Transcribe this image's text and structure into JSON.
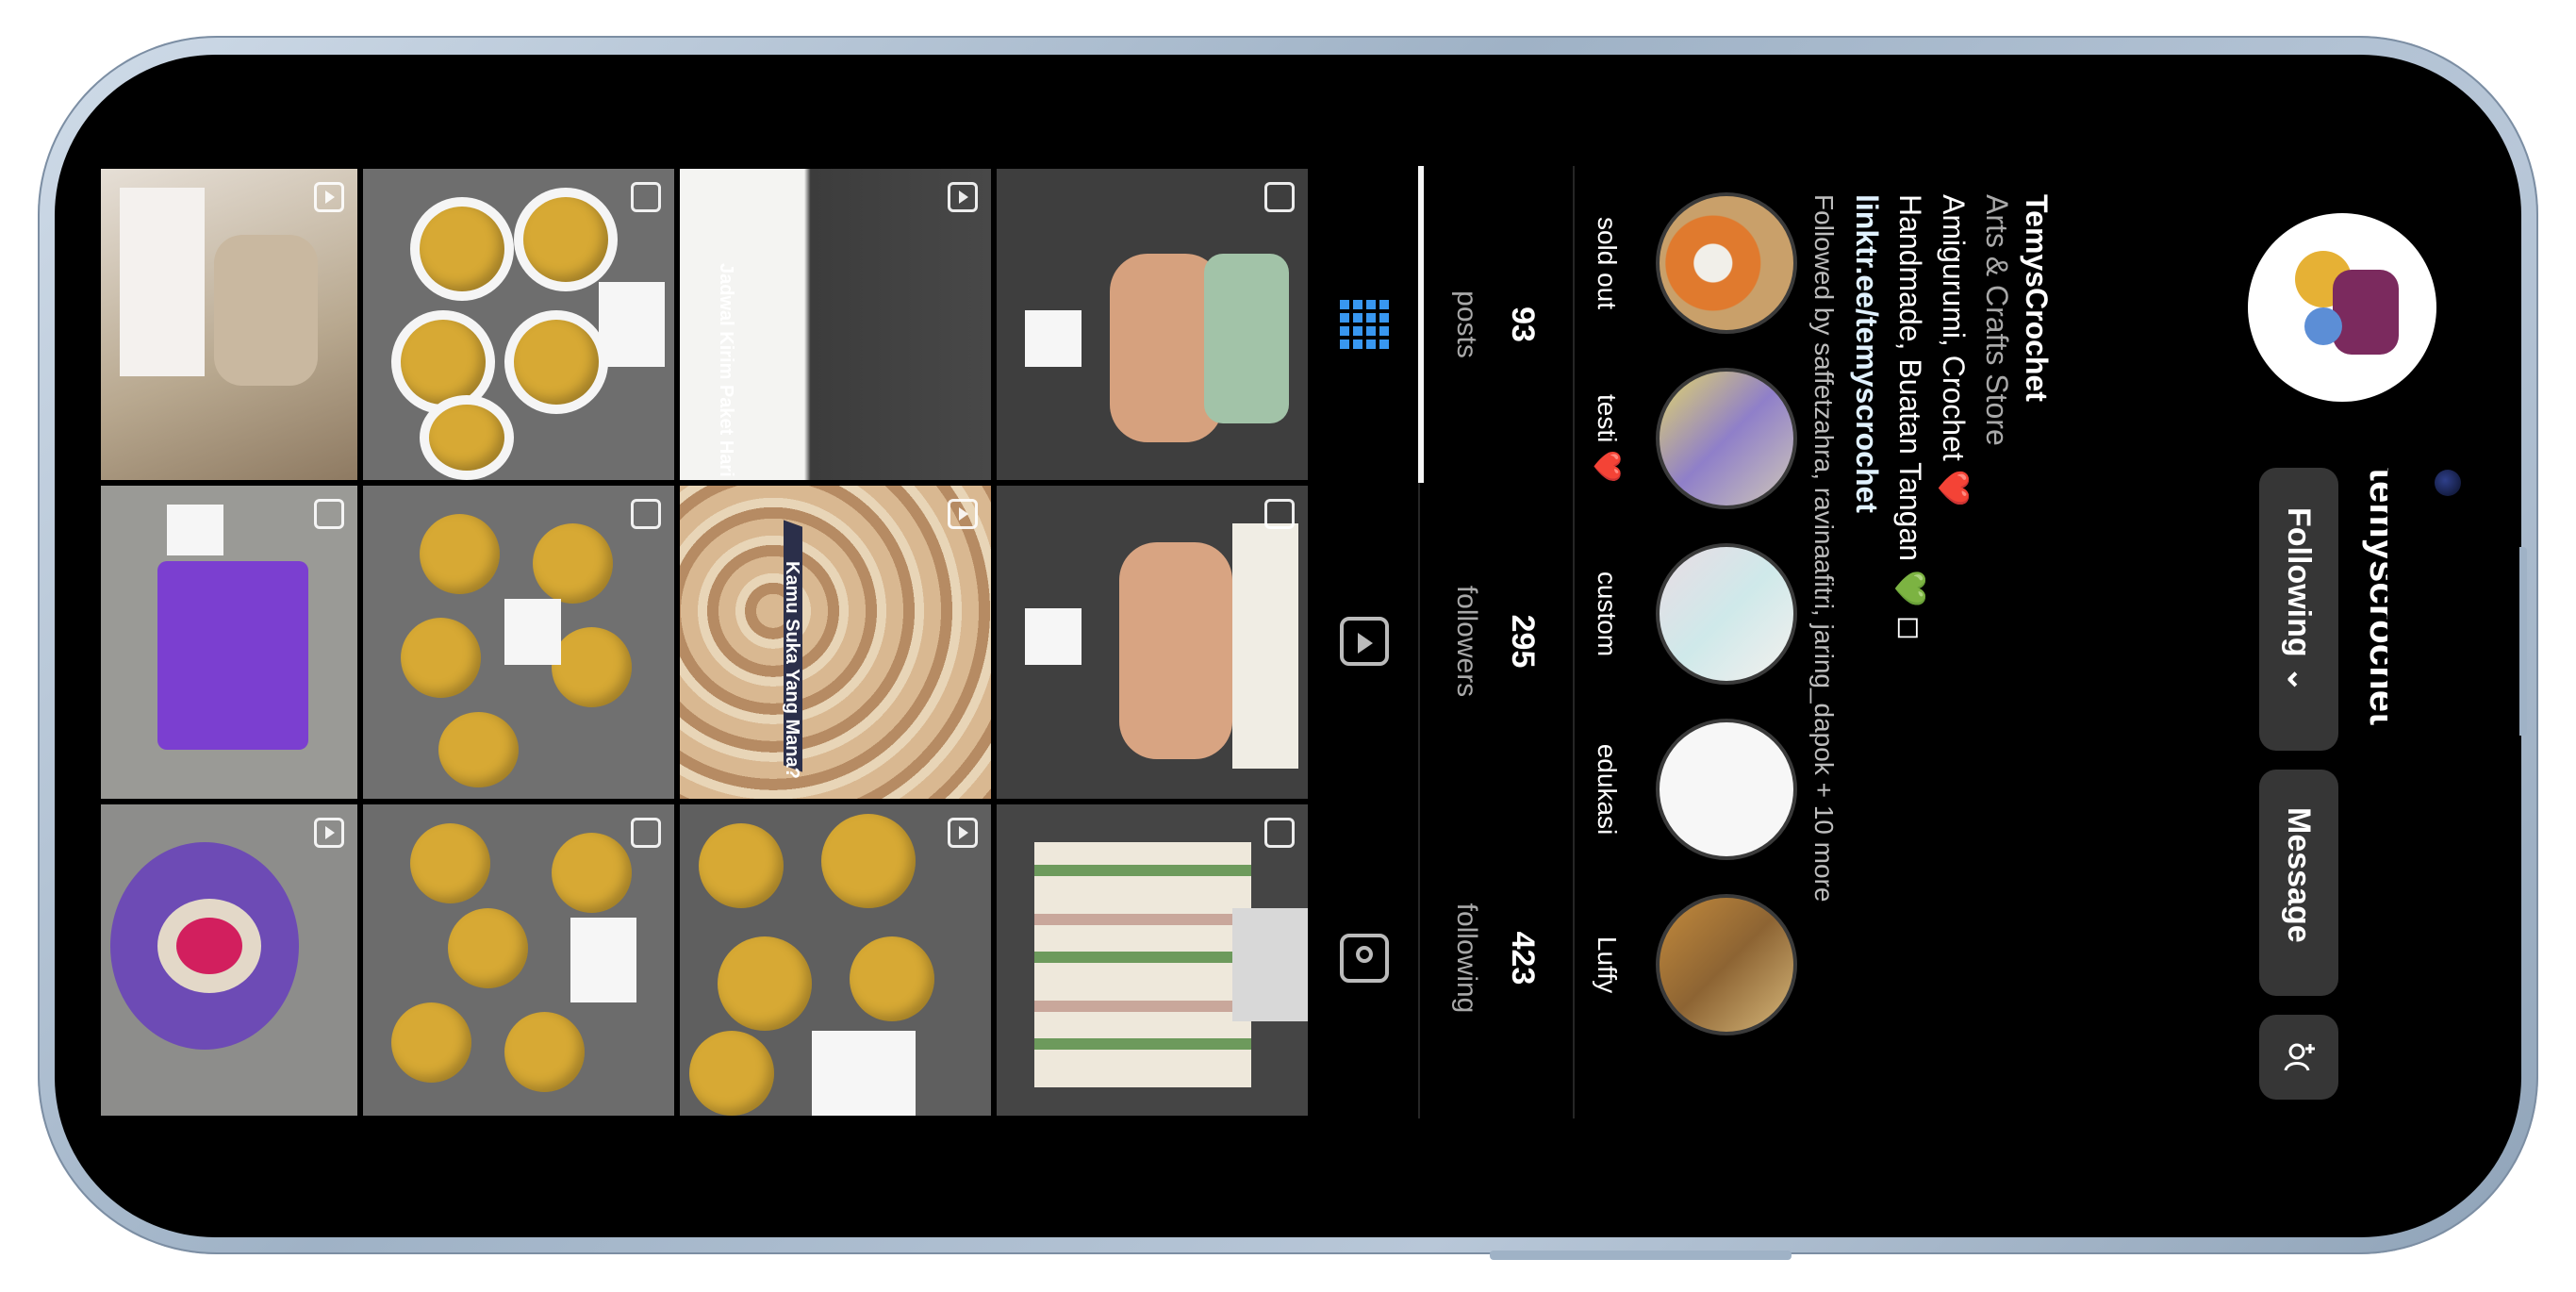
{
  "profile": {
    "username": "temyscrochet",
    "display_name": "TemysCrochet",
    "category": "Arts & Crafts Store",
    "bio_lines": [
      "Amigurumi, Crochet ❤️",
      "Handmade, Buatan Tangan 💚 ◻"
    ],
    "link": "linktr.ee/temyscrochet",
    "followed_by": "Followed by saffetzahra, ravinaafitri, jaring_dapok + 10 more"
  },
  "actions": {
    "following_label": "Following ⌄",
    "message_label": "Message",
    "add_person_icon": "add-person-icon"
  },
  "stats": [
    {
      "value": "93",
      "label": "posts"
    },
    {
      "value": "295",
      "label": "followers"
    },
    {
      "value": "423",
      "label": "following"
    }
  ],
  "highlights": [
    {
      "label": "sold out"
    },
    {
      "label": "testi ❤️"
    },
    {
      "label": "custom"
    },
    {
      "label": "edukasi"
    },
    {
      "label": "Luffy"
    }
  ],
  "tabs": [
    {
      "icon": "grid-icon",
      "active": true
    },
    {
      "icon": "reels-icon",
      "active": false
    },
    {
      "icon": "tagged-icon",
      "active": false
    }
  ],
  "colors": {
    "accent": "#3897f0",
    "background": "#000000",
    "button": "#363636",
    "crochet_yellow": "#d7a934",
    "purple": "#7b3fd0"
  },
  "post_overlay_texts": {
    "post_7": "Jadwal Kirim Paket Hari Ini",
    "post_8": "Kamu Suka Yang Mana?"
  }
}
